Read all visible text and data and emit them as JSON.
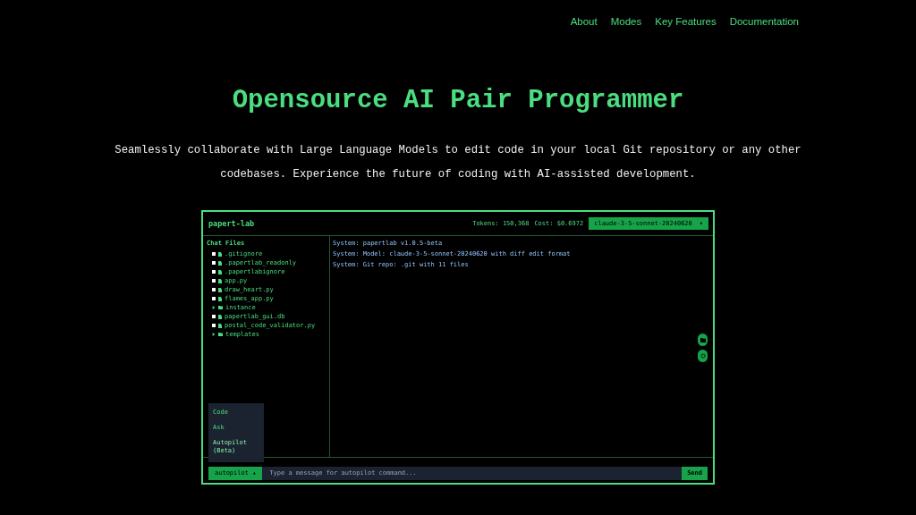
{
  "nav": [
    "About",
    "Modes",
    "Key Features",
    "Documentation"
  ],
  "hero": {
    "title": "Opensource AI Pair Programmer",
    "subtitle": "Seamlessly collaborate with Large Language Models to edit code in your local Git repository or any other codebases. Experience the future of coding with AI-assisted development."
  },
  "app": {
    "title": "papert-lab",
    "tokens": "Tokens: 150,368",
    "cost": "Cost: $0.6972",
    "model": "claude-3-5-sonnet-20240620",
    "model_caret": "▾",
    "files_heading": "Chat Files",
    "files": [
      {
        "kind": "file",
        "name": ".gitignore",
        "checked": false
      },
      {
        "kind": "file",
        "name": ".papertlab_readonly",
        "checked": false
      },
      {
        "kind": "file",
        "name": ".papertlabignore",
        "checked": false
      },
      {
        "kind": "file",
        "name": "app.py",
        "checked": false
      },
      {
        "kind": "file",
        "name": "draw_heart.py",
        "checked": false
      },
      {
        "kind": "file",
        "name": "flames_app.py",
        "checked": false
      },
      {
        "kind": "folder",
        "name": "instance",
        "expanded": false
      },
      {
        "kind": "file",
        "name": "papertlab_gui.db",
        "checked": false
      },
      {
        "kind": "file",
        "name": "postal_code_validator.py",
        "checked": false
      },
      {
        "kind": "folder",
        "name": "templates",
        "expanded": false
      }
    ],
    "messages": [
      "System: papertlab v1.0.5-beta",
      "System: Model: claude-3-5-sonnet-20240620 with diff edit format",
      "System: Git repo: .git with 11 files"
    ],
    "mode_menu": [
      {
        "label": "Code",
        "selected": false
      },
      {
        "label": "Ask",
        "selected": false
      },
      {
        "label": "Autopilot (Beta)",
        "selected": true
      }
    ],
    "mode_button": "autopilot",
    "mode_caret": "▴",
    "input_placeholder": "Type a message for autopilot command...",
    "send": "Send"
  }
}
